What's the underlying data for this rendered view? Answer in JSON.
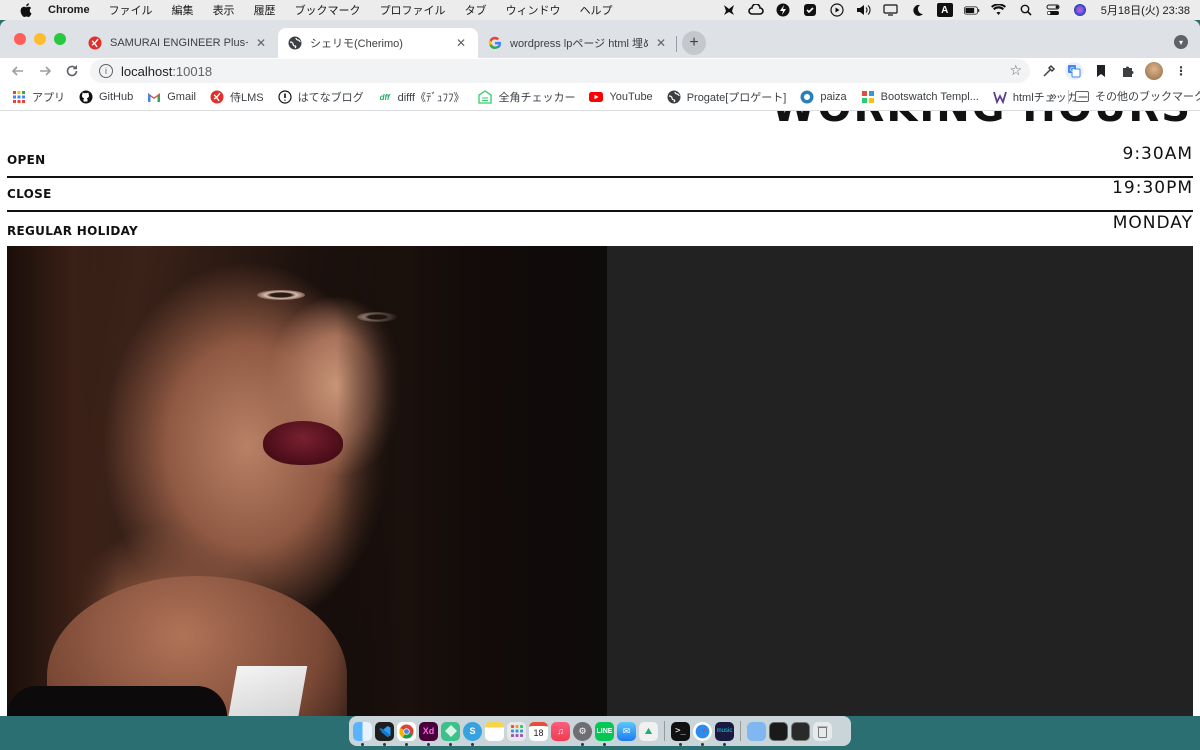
{
  "menubar": {
    "app_name": "Chrome",
    "items": [
      "ファイル",
      "編集",
      "表示",
      "履歴",
      "ブックマーク",
      "プロファイル",
      "タブ",
      "ウィンドウ",
      "ヘルプ"
    ],
    "clock": "5月18日(火)  23:38",
    "status_icons": [
      "copilot-icon",
      "creative-cloud-icon",
      "bolt-icon",
      "check-icon",
      "play-icon",
      "volume-icon",
      "display-icon",
      "moon-icon",
      "input-source-icon",
      "battery-icon",
      "wifi-icon",
      "spotlight-icon",
      "control-center-icon",
      "siri-icon"
    ],
    "input_source": "A"
  },
  "tabs": [
    {
      "title": "SAMURAI ENGINEER Plus+ - E",
      "icon": "samurai-icon",
      "active": false
    },
    {
      "title": "シェリモ(Cherimo)",
      "icon": "globe-icon",
      "active": true
    },
    {
      "title": "wordpress lpページ html 埋め込",
      "icon": "google-icon",
      "active": false
    }
  ],
  "toolbar": {
    "url_host": "localhost",
    "url_port": ":10018"
  },
  "bookmarks": [
    {
      "label": "アプリ",
      "icon": "apps-grid-icon"
    },
    {
      "label": "GitHub",
      "icon": "github-icon"
    },
    {
      "label": "Gmail",
      "icon": "gmail-icon"
    },
    {
      "label": "侍LMS",
      "icon": "samurai-icon"
    },
    {
      "label": "はてなブログ",
      "icon": "hatena-icon"
    },
    {
      "label": "difff《ﾃﾞｭﾌﾌ》",
      "icon": "difff-icon"
    },
    {
      "label": "全角チェッカー",
      "icon": "checker-icon"
    },
    {
      "label": "YouTube",
      "icon": "youtube-icon"
    },
    {
      "label": "Progate[プロゲート]",
      "icon": "globe-icon"
    },
    {
      "label": "paiza",
      "icon": "paiza-icon"
    },
    {
      "label": "Bootswatch Templ...",
      "icon": "bootswatch-icon"
    },
    {
      "label": "htmlチェッカー",
      "icon": "html-checker-icon"
    }
  ],
  "bookmarks_more": "»",
  "bookmarks_other": "その他のブックマーク",
  "page": {
    "heading_partial": "WORKING HOURS",
    "rows": [
      {
        "label": "OPEN",
        "value": "9:30AM"
      },
      {
        "label": "CLOSE",
        "value": "19:30PM"
      },
      {
        "label": "REGULAR HOLIDAY",
        "value": "MONDAY"
      }
    ],
    "hero_panel_color": "#222222"
  },
  "dock": {
    "apps": [
      "finder-icon",
      "vscode-icon",
      "chrome-icon",
      "xd-icon",
      "sourcetree-icon",
      "skitch-icon",
      "notes-icon",
      "launchpad-icon",
      "calendar-icon",
      "music-icon",
      "system-preferences-icon",
      "line-icon",
      "mail-icon",
      "preview-icon",
      "terminal-icon",
      "safari-icon",
      "amazon-music-icon",
      "folder-icon",
      "screenshot-icon",
      "window-icon",
      "trash-icon"
    ],
    "calendar_day": "18",
    "amazon_label": "music"
  },
  "colors": {
    "desktop": "#2b6f73",
    "tab_strip": "#dee1e6",
    "hero_panel": "#222222"
  }
}
